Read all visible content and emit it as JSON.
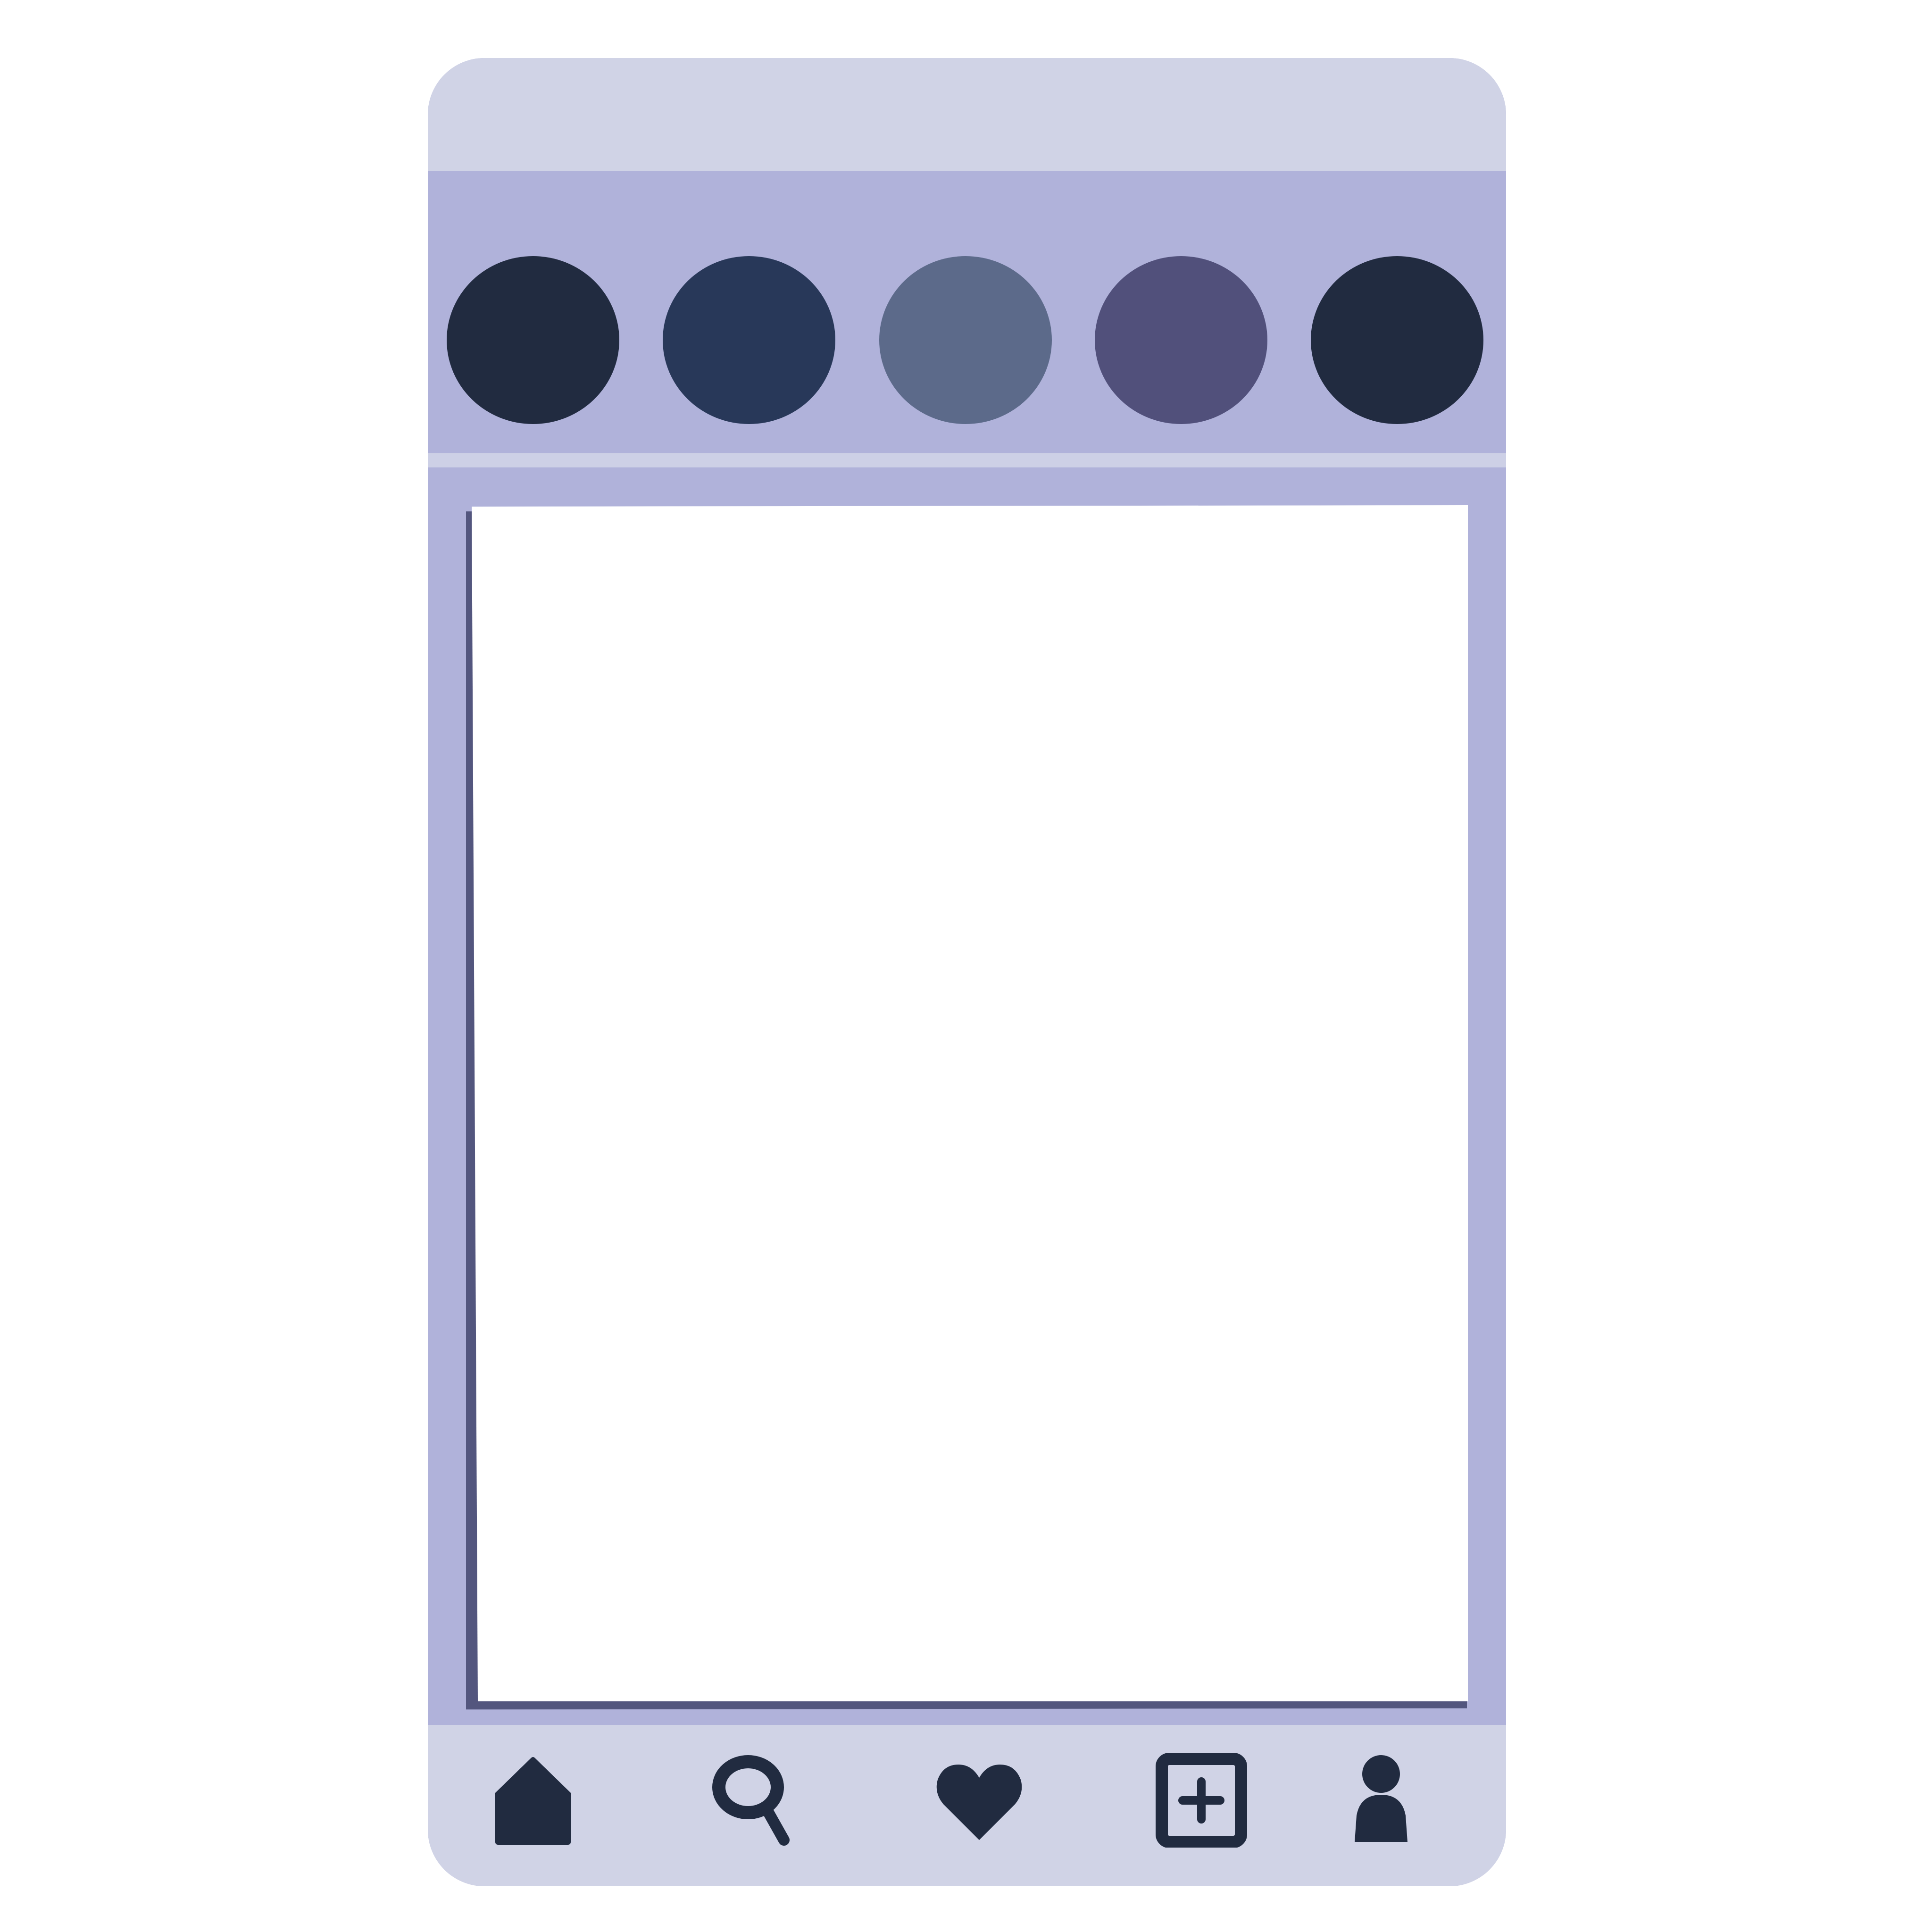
{
  "colors": {
    "frame_outer": "#d0d3e6",
    "frame_inner": "#b0b2da",
    "post_shadow": "#53567e",
    "post_background": "#ffffff",
    "icon": "#212b40"
  },
  "stories": [
    {
      "name": "story-avatar",
      "color": "#212b40"
    },
    {
      "name": "story-avatar",
      "color": "#283859"
    },
    {
      "name": "story-avatar",
      "color": "#5c6a8a"
    },
    {
      "name": "story-avatar",
      "color": "#51507b"
    },
    {
      "name": "story-avatar",
      "color": "#212b40"
    }
  ],
  "nav": [
    {
      "icon": "home-icon"
    },
    {
      "icon": "search-icon"
    },
    {
      "icon": "heart-icon"
    },
    {
      "icon": "add-post-icon"
    },
    {
      "icon": "profile-icon"
    }
  ]
}
